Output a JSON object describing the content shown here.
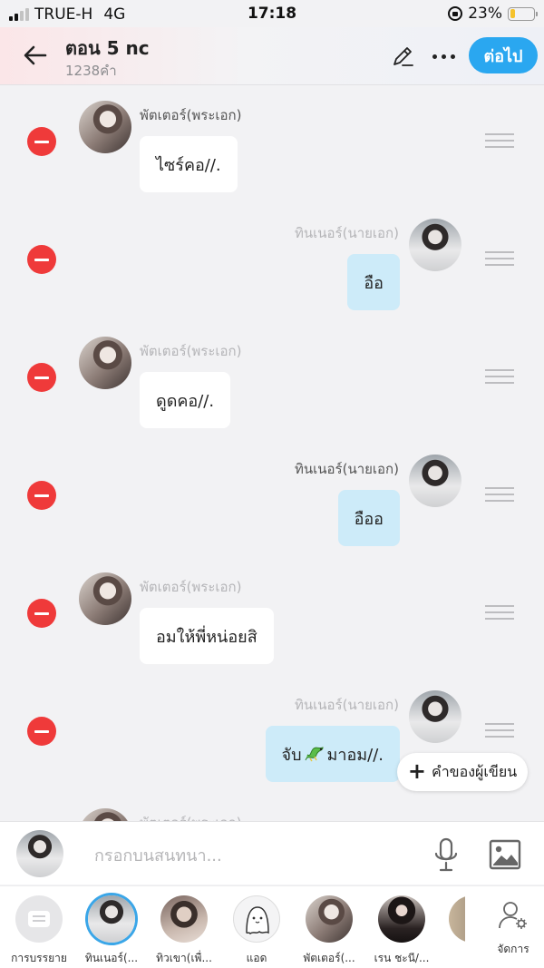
{
  "status_bar": {
    "carrier": "TRUE-H",
    "network": "4G",
    "time": "17:18",
    "battery": "23%",
    "battery_level": 0.23
  },
  "header": {
    "title": "ตอน 5 nc",
    "subtitle": "1238คำ",
    "next_label": "ต่อไป"
  },
  "messages": [
    {
      "side": "left",
      "name": "พัตเตอร์(พระเอก)",
      "text": "ไซร์คอ//.",
      "name_faded": false,
      "avatar": "av-boy"
    },
    {
      "side": "right",
      "name": "ทินเนอร์(นายเอก)",
      "text": "อือ",
      "name_faded": true,
      "avatar": "av-man"
    },
    {
      "side": "left",
      "name": "พัตเตอร์(พระเอก)",
      "text": "ดูดคอ//.",
      "name_faded": true,
      "avatar": "av-boy"
    },
    {
      "side": "right",
      "name": "ทินเนอร์(นายเอก)",
      "text": "อืออ",
      "name_faded": false,
      "avatar": "av-man"
    },
    {
      "side": "left",
      "name": "พัตเตอร์(พระเอก)",
      "text": "อมให้พี่หน่อยสิ",
      "name_faded": true,
      "avatar": "av-boy"
    },
    {
      "side": "right",
      "name": "ทินเนอร์(นายเอก)",
      "text_before": "จับ",
      "text_after": "มาอม//.",
      "sticker": "dragon-emoji",
      "name_faded": true,
      "avatar": "av-man"
    },
    {
      "side": "left",
      "name": "พัตเตอร์(พระเอก)",
      "text": "",
      "name_faded": true,
      "avatar": "av-boy"
    }
  ],
  "writer_note_label": "คำของผู้เขียน",
  "composer": {
    "placeholder": "กรอกบนสนทนา..."
  },
  "characters": [
    {
      "label": "การบรรยาย",
      "style": "narr",
      "selected": false
    },
    {
      "label": "ทินเนอร์(...",
      "style": "av-man",
      "selected": true
    },
    {
      "label": "ทิวเขา(เพื่...",
      "style": "c-boy2",
      "selected": false
    },
    {
      "label": "แอด",
      "style": "c-ghost",
      "selected": false
    },
    {
      "label": "พัตเตอร์(...",
      "style": "av-boy",
      "selected": false
    },
    {
      "label": "เรน ชะนี/...",
      "style": "c-woman",
      "selected": false
    },
    {
      "label": "",
      "style": "c-partial",
      "selected": false
    }
  ],
  "manage_label": "จัดการ",
  "colors": {
    "accent": "#2aa7f0",
    "remove": "#ef3a3a",
    "right_bubble": "#cdebf9",
    "battery": "#f5c22c"
  }
}
